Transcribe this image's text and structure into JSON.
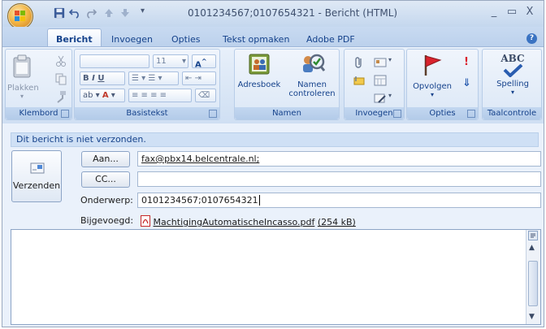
{
  "window": {
    "title": "0101234567;0107654321 - Bericht (HTML)",
    "controls": [
      "_",
      "▭",
      "X"
    ]
  },
  "tabs": [
    {
      "label": "Bericht",
      "active": true
    },
    {
      "label": "Invoegen"
    },
    {
      "label": "Opties"
    },
    {
      "label": "Tekst opmaken"
    },
    {
      "label": "Adobe PDF"
    }
  ],
  "ribbon": {
    "klembord": {
      "label": "Klembord",
      "paste": "Plakken"
    },
    "basistekst": {
      "label": "Basistekst",
      "font_size": "11"
    },
    "namen": {
      "label": "Namen",
      "adresboek": "Adresboek",
      "controleren_line1": "Namen",
      "controleren_line2": "controleren"
    },
    "invoegen": {
      "label": "Invoegen"
    },
    "opties": {
      "label": "Opties",
      "opvolgen": "Opvolgen"
    },
    "taalcontrole": {
      "label": "Taalcontrole",
      "spelling": "Spelling",
      "abc": "ABC"
    }
  },
  "infobar": {
    "text": "Dit bericht is niet verzonden."
  },
  "send_button": {
    "label": "Verzenden"
  },
  "to": {
    "button": "Aan...",
    "value": "fax@pbx14.belcentrale.nl;"
  },
  "cc": {
    "button": "CC...",
    "value": ""
  },
  "subject": {
    "label": "Onderwerp:",
    "value": "0101234567;0107654321"
  },
  "attachment": {
    "label": "Bijgevoegd:",
    "filename": "MachtigingAutomatischeIncasso.pdf",
    "size": "(254 kB)"
  },
  "colors": {
    "accent": "#15428b",
    "ribbon": "#dbe7f6",
    "flag": "#d9232d"
  }
}
